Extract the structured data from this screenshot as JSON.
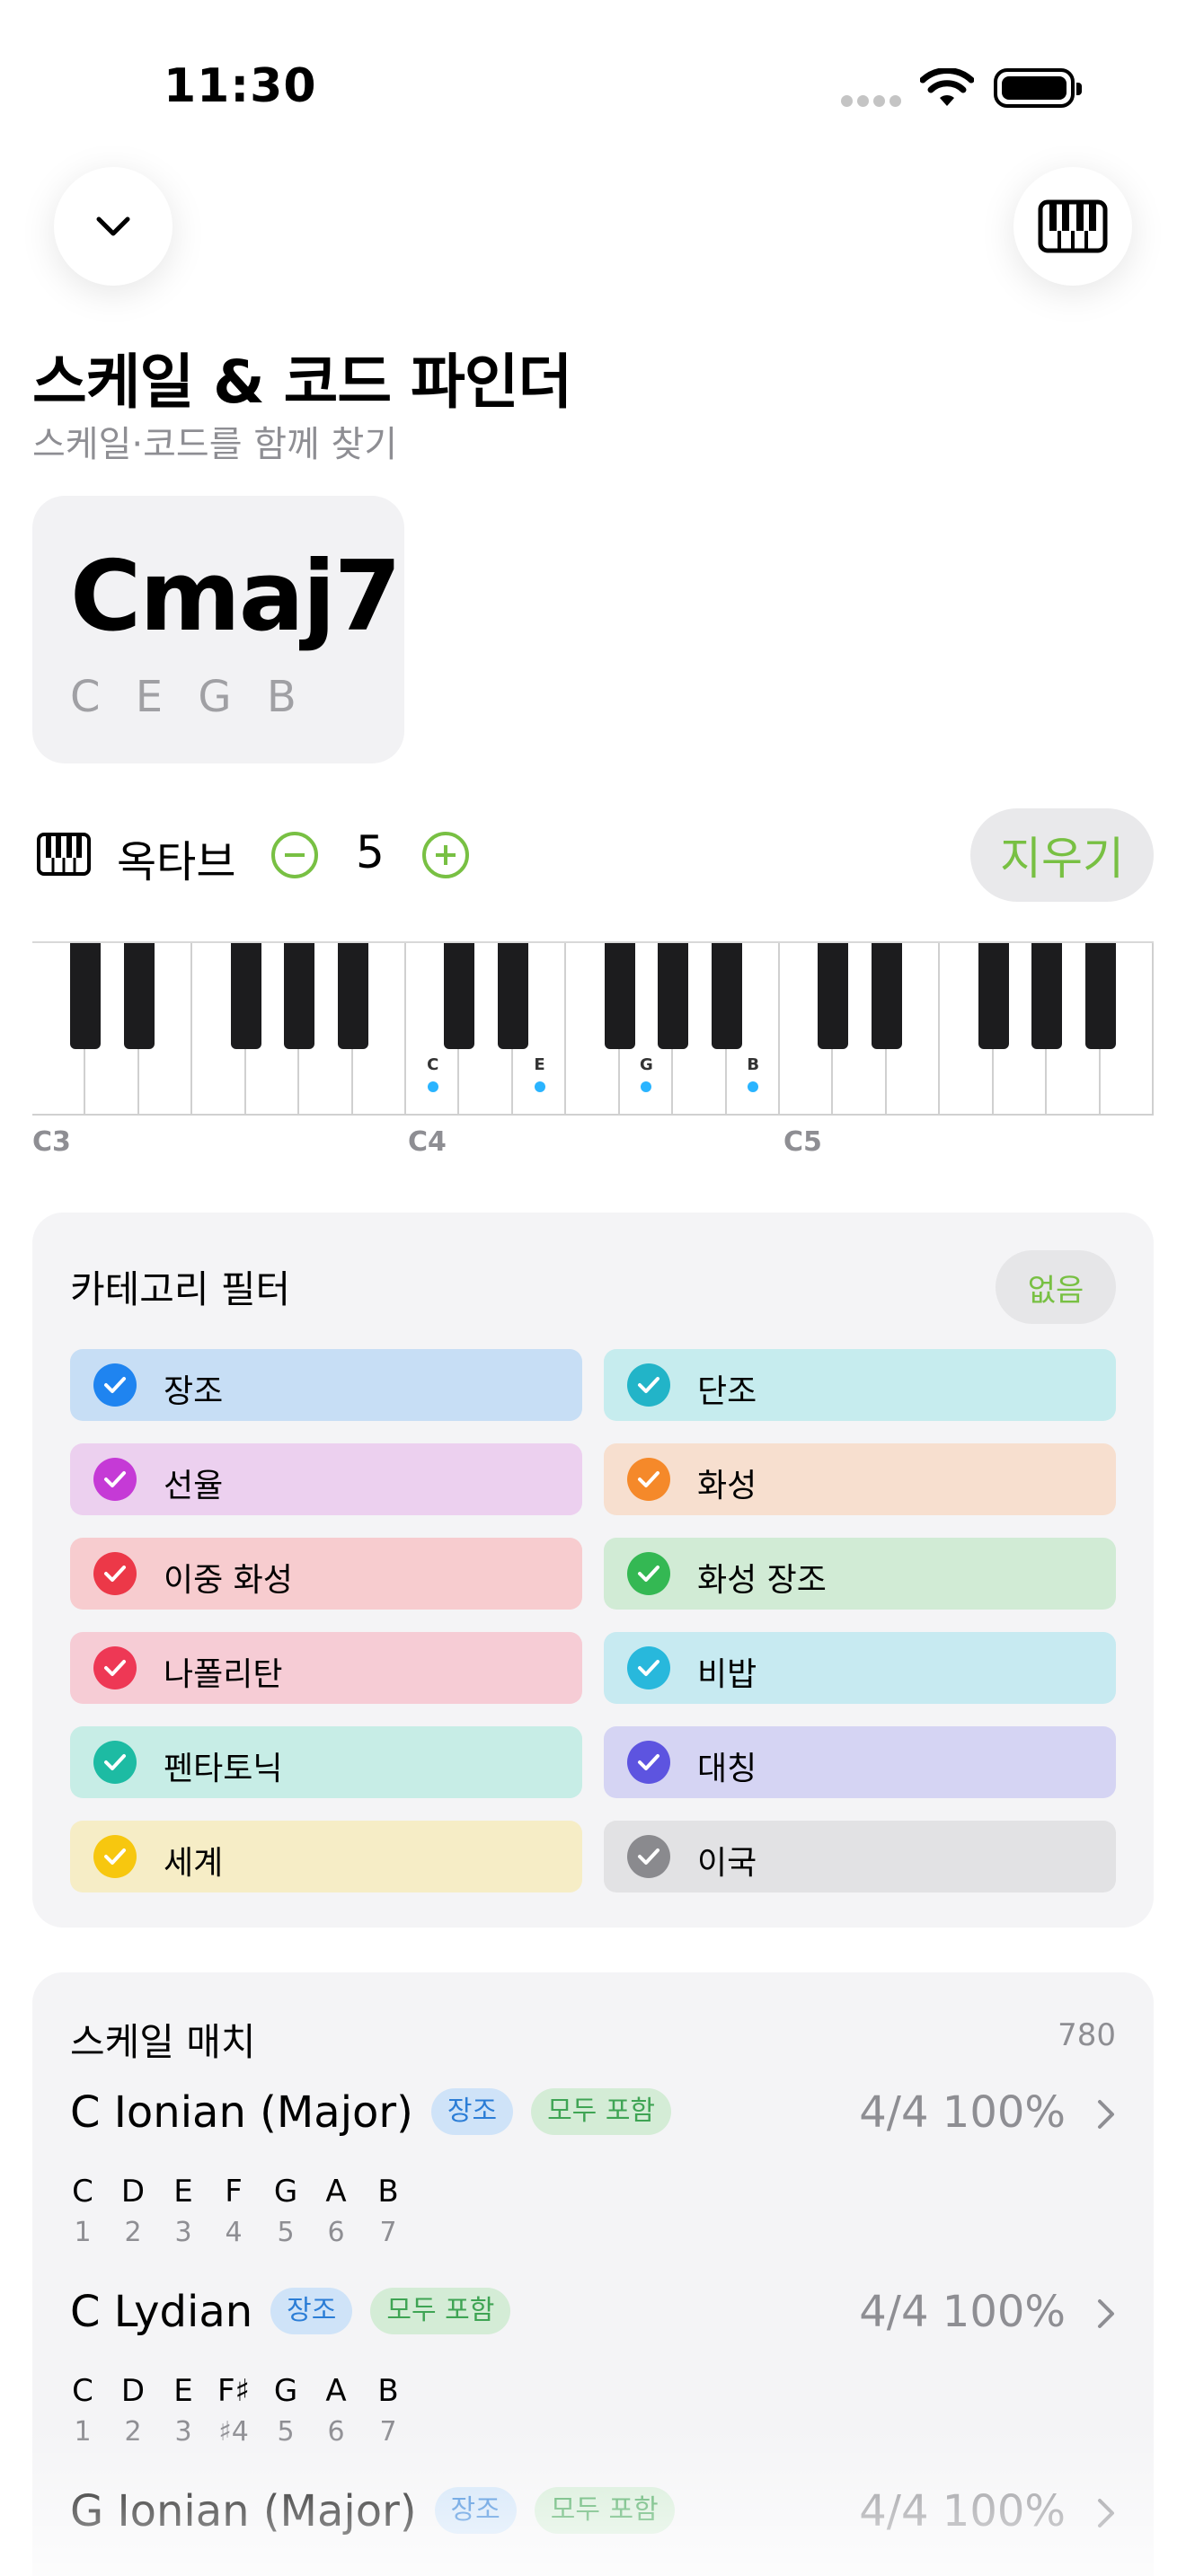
{
  "status_bar": {
    "time": "11:30"
  },
  "header": {
    "title": "스케일 & 코드 파인더",
    "subtitle": "스케일·코드를 함께 찾기"
  },
  "chord": {
    "name": "Cmaj7",
    "notes": "C E G B"
  },
  "octave": {
    "label": "옥타브",
    "value": "5",
    "clear_label": "지우기"
  },
  "piano": {
    "octave_labels": [
      "C3",
      "C4",
      "C5"
    ],
    "highlighted": [
      {
        "note": "C",
        "white_index": 7
      },
      {
        "note": "E",
        "white_index": 9
      },
      {
        "note": "G",
        "white_index": 11
      },
      {
        "note": "B",
        "white_index": 13
      }
    ],
    "highlight_color": "#2ab4ff"
  },
  "filter": {
    "title": "카테고리 필터",
    "none_label": "없음",
    "chips": [
      {
        "label": "장조",
        "color": "#1f84f0",
        "bg": "#c7def5"
      },
      {
        "label": "단조",
        "color": "#22b4c8",
        "bg": "#c6ecee"
      },
      {
        "label": "선율",
        "color": "#c53ad6",
        "bg": "#ecd0ef"
      },
      {
        "label": "화성",
        "color": "#f5892a",
        "bg": "#f7dfcf"
      },
      {
        "label": "이중 화성",
        "color": "#ec3848",
        "bg": "#f7cccf"
      },
      {
        "label": "화성 장조",
        "color": "#34b853",
        "bg": "#d1ebd5"
      },
      {
        "label": "나폴리탄",
        "color": "#ee3855",
        "bg": "#f6ccd5"
      },
      {
        "label": "비밥",
        "color": "#28b8dc",
        "bg": "#c7eaf1"
      },
      {
        "label": "펜타토닉",
        "color": "#1dbba3",
        "bg": "#c7ede6"
      },
      {
        "label": "대칭",
        "color": "#5d54e0",
        "bg": "#d5d4f3"
      },
      {
        "label": "세계",
        "color": "#f7c70f",
        "bg": "#f6edc6"
      },
      {
        "label": "이국",
        "color": "#8a8a8e",
        "bg": "#e2e2e4"
      }
    ]
  },
  "scales": {
    "title": "스케일 매치",
    "count": "780",
    "items": [
      {
        "name": "C Ionian (Major)",
        "tags": [
          "장조",
          "모두 포함"
        ],
        "score": "4/4  100%",
        "notes": [
          "C",
          "D",
          "E",
          "F",
          "G",
          "A",
          "B"
        ],
        "degrees": [
          "1",
          "2",
          "3",
          "4",
          "5",
          "6",
          "7"
        ]
      },
      {
        "name": "C Lydian",
        "tags": [
          "장조",
          "모두 포함"
        ],
        "score": "4/4  100%",
        "notes": [
          "C",
          "D",
          "E",
          "F♯",
          "G",
          "A",
          "B"
        ],
        "degrees": [
          "1",
          "2",
          "3",
          "♯4",
          "5",
          "6",
          "7"
        ]
      },
      {
        "name": "G Ionian (Major)",
        "tags": [
          "장조",
          "모두 포함"
        ],
        "score": "4/4  100%",
        "notes": [],
        "degrees": []
      }
    ]
  }
}
